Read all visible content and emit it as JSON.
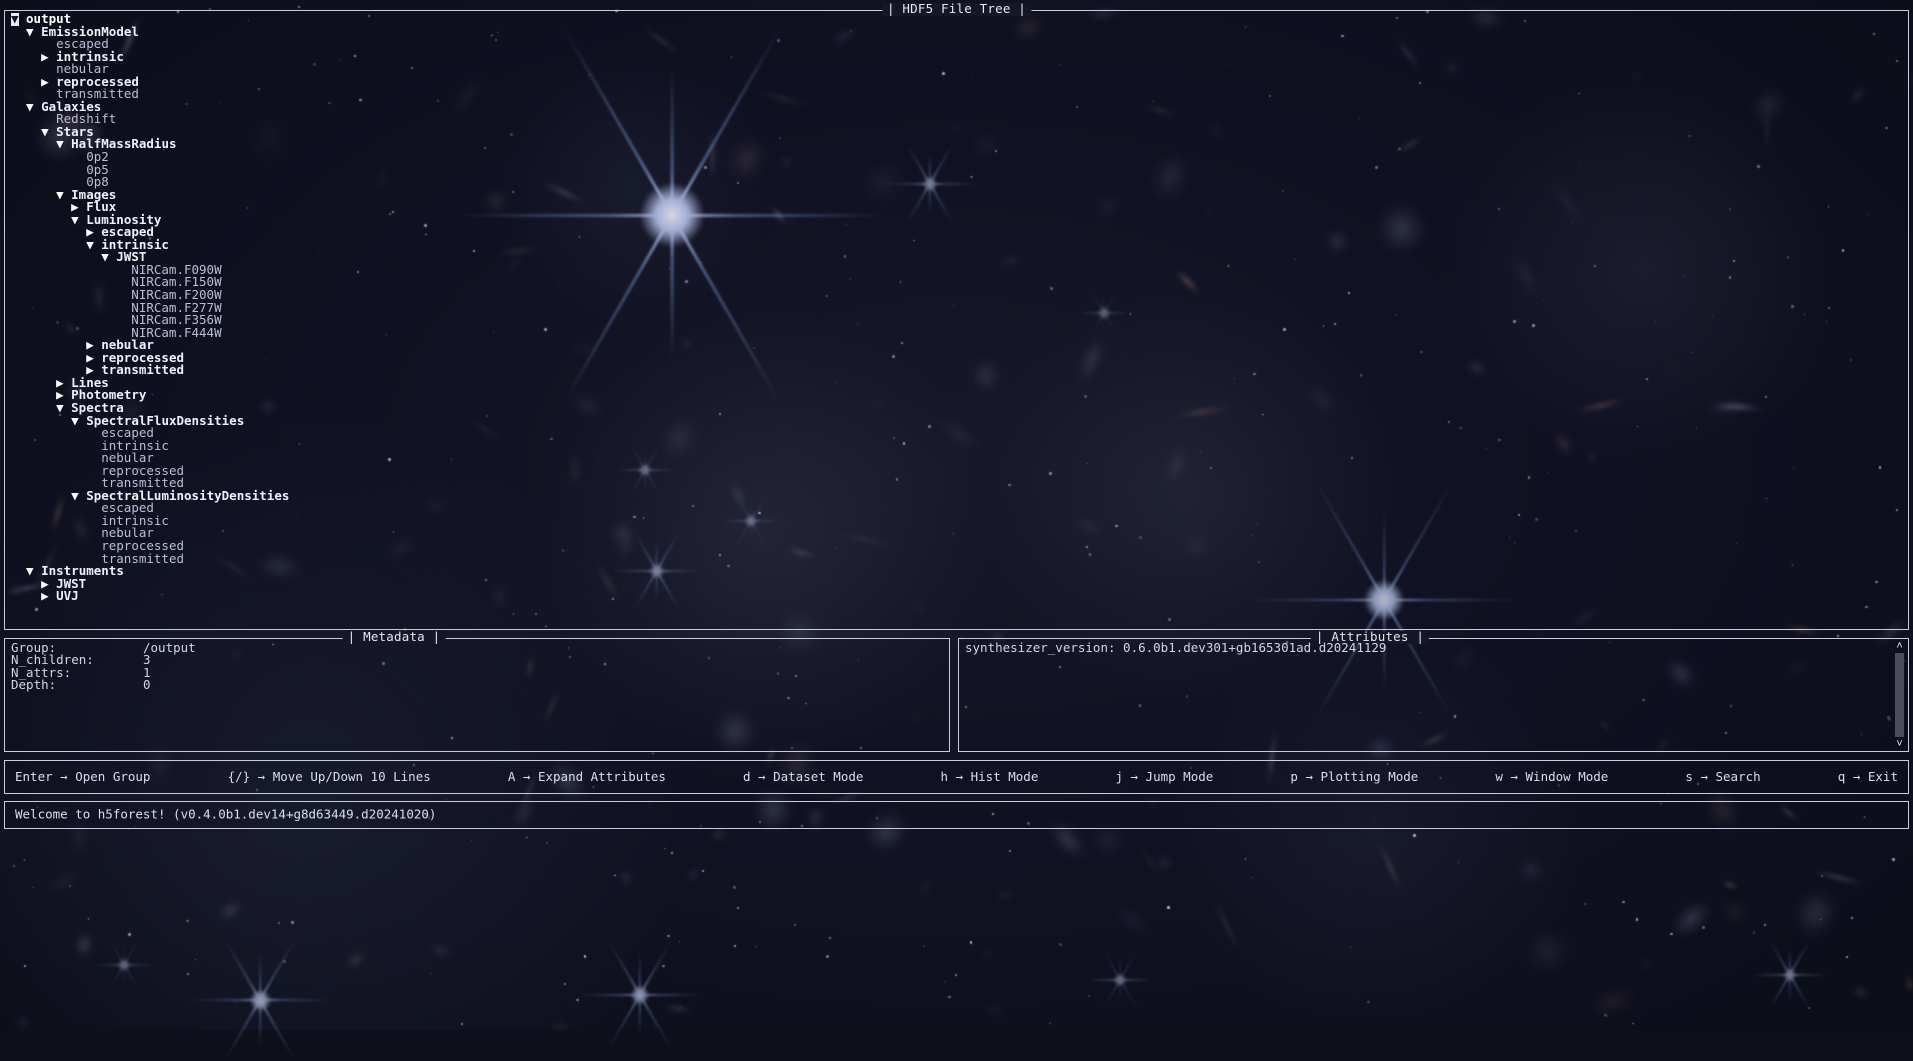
{
  "app": {
    "name": "h5forest",
    "tree_panel_title": "| HDF5 File Tree |",
    "metadata_panel_title": "| Metadata |",
    "attributes_panel_title": "| Attributes |"
  },
  "tree": {
    "cursor_glyph": "▼",
    "expanded_glyph": "▼",
    "collapsed_glyph": "▶",
    "rows": [
      {
        "indent": 0,
        "marker": "cursor",
        "label": "output",
        "type": "group"
      },
      {
        "indent": 1,
        "marker": "expanded",
        "label": "EmissionModel",
        "type": "group"
      },
      {
        "indent": 2,
        "marker": "none",
        "label": "escaped",
        "type": "dataset"
      },
      {
        "indent": 2,
        "marker": "collapsed",
        "label": "intrinsic",
        "type": "group"
      },
      {
        "indent": 2,
        "marker": "none",
        "label": "nebular",
        "type": "dataset"
      },
      {
        "indent": 2,
        "marker": "collapsed",
        "label": "reprocessed",
        "type": "group"
      },
      {
        "indent": 2,
        "marker": "none",
        "label": "transmitted",
        "type": "dataset"
      },
      {
        "indent": 1,
        "marker": "expanded",
        "label": "Galaxies",
        "type": "group"
      },
      {
        "indent": 2,
        "marker": "none",
        "label": "Redshift",
        "type": "dataset"
      },
      {
        "indent": 2,
        "marker": "expanded",
        "label": "Stars",
        "type": "group"
      },
      {
        "indent": 3,
        "marker": "expanded",
        "label": "HalfMassRadius",
        "type": "group"
      },
      {
        "indent": 4,
        "marker": "none",
        "label": "0p2",
        "type": "dataset"
      },
      {
        "indent": 4,
        "marker": "none",
        "label": "0p5",
        "type": "dataset"
      },
      {
        "indent": 4,
        "marker": "none",
        "label": "0p8",
        "type": "dataset"
      },
      {
        "indent": 3,
        "marker": "expanded",
        "label": "Images",
        "type": "group"
      },
      {
        "indent": 4,
        "marker": "collapsed",
        "label": "Flux",
        "type": "group"
      },
      {
        "indent": 4,
        "marker": "expanded",
        "label": "Luminosity",
        "type": "group"
      },
      {
        "indent": 5,
        "marker": "collapsed",
        "label": "escaped",
        "type": "group"
      },
      {
        "indent": 5,
        "marker": "expanded",
        "label": "intrinsic",
        "type": "group"
      },
      {
        "indent": 6,
        "marker": "expanded",
        "label": "JWST",
        "type": "group"
      },
      {
        "indent": 7,
        "marker": "none",
        "label": "NIRCam.F090W",
        "type": "dataset"
      },
      {
        "indent": 7,
        "marker": "none",
        "label": "NIRCam.F150W",
        "type": "dataset"
      },
      {
        "indent": 7,
        "marker": "none",
        "label": "NIRCam.F200W",
        "type": "dataset"
      },
      {
        "indent": 7,
        "marker": "none",
        "label": "NIRCam.F277W",
        "type": "dataset"
      },
      {
        "indent": 7,
        "marker": "none",
        "label": "NIRCam.F356W",
        "type": "dataset"
      },
      {
        "indent": 7,
        "marker": "none",
        "label": "NIRCam.F444W",
        "type": "dataset"
      },
      {
        "indent": 5,
        "marker": "collapsed",
        "label": "nebular",
        "type": "group"
      },
      {
        "indent": 5,
        "marker": "collapsed",
        "label": "reprocessed",
        "type": "group"
      },
      {
        "indent": 5,
        "marker": "collapsed",
        "label": "transmitted",
        "type": "group"
      },
      {
        "indent": 3,
        "marker": "collapsed",
        "label": "Lines",
        "type": "group"
      },
      {
        "indent": 3,
        "marker": "collapsed",
        "label": "Photometry",
        "type": "group"
      },
      {
        "indent": 3,
        "marker": "expanded",
        "label": "Spectra",
        "type": "group"
      },
      {
        "indent": 4,
        "marker": "expanded",
        "label": "SpectralFluxDensities",
        "type": "group"
      },
      {
        "indent": 5,
        "marker": "none",
        "label": "escaped",
        "type": "dataset"
      },
      {
        "indent": 5,
        "marker": "none",
        "label": "intrinsic",
        "type": "dataset"
      },
      {
        "indent": 5,
        "marker": "none",
        "label": "nebular",
        "type": "dataset"
      },
      {
        "indent": 5,
        "marker": "none",
        "label": "reprocessed",
        "type": "dataset"
      },
      {
        "indent": 5,
        "marker": "none",
        "label": "transmitted",
        "type": "dataset"
      },
      {
        "indent": 4,
        "marker": "expanded",
        "label": "SpectralLuminosityDensities",
        "type": "group"
      },
      {
        "indent": 5,
        "marker": "none",
        "label": "escaped",
        "type": "dataset"
      },
      {
        "indent": 5,
        "marker": "none",
        "label": "intrinsic",
        "type": "dataset"
      },
      {
        "indent": 5,
        "marker": "none",
        "label": "nebular",
        "type": "dataset"
      },
      {
        "indent": 5,
        "marker": "none",
        "label": "reprocessed",
        "type": "dataset"
      },
      {
        "indent": 5,
        "marker": "none",
        "label": "transmitted",
        "type": "dataset"
      },
      {
        "indent": 1,
        "marker": "expanded",
        "label": "Instruments",
        "type": "group"
      },
      {
        "indent": 2,
        "marker": "collapsed",
        "label": "JWST",
        "type": "group"
      },
      {
        "indent": 2,
        "marker": "collapsed",
        "label": "UVJ",
        "type": "group"
      }
    ]
  },
  "metadata": {
    "rows": [
      {
        "key": "Group:",
        "value": "/output"
      },
      {
        "key": "N_children:",
        "value": "3"
      },
      {
        "key": "N_attrs:",
        "value": "1"
      },
      {
        "key": "Depth:",
        "value": "0"
      }
    ]
  },
  "attributes": {
    "rows": [
      "synthesizer_version: 0.6.0b1.dev301+gb165301ad.d20241129"
    ],
    "scroll_up_glyph": "˄",
    "scroll_down_glyph": "˅"
  },
  "keybindings": [
    "Enter → Open Group",
    "{/} → Move Up/Down 10 Lines",
    "A → Expand Attributes",
    "d → Dataset Mode",
    "h → Hist Mode",
    "j → Jump Mode",
    "p → Plotting Mode",
    "w → Window Mode",
    "s → Search",
    "q → Exit"
  ],
  "status": {
    "message": "Welcome to h5forest! (v0.4.0b1.dev14+g8d63449.d20241020)"
  },
  "colors": {
    "background": "#0d0f1a",
    "border": "#c9ccdf",
    "text": "#d6d9e8",
    "group_text": "#eef0fa",
    "dataset_text": "#b9bfd4",
    "cursor_bg": "#e7e9f5",
    "scrollbar_thumb": "#4a4d5e"
  }
}
